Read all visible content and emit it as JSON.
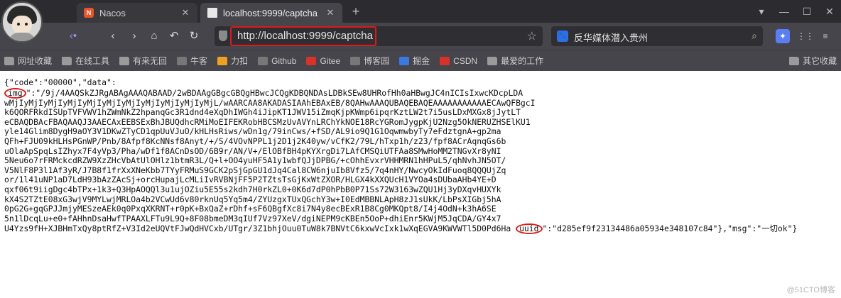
{
  "tabs": [
    {
      "title": "Nacos",
      "icon": "nacos-logo-icon"
    },
    {
      "title": "localhost:9999/captcha",
      "icon": "document-icon"
    }
  ],
  "nav": {
    "url": "http://localhost:9999/captcha",
    "search_text": "反华媒体潜入贵州"
  },
  "bookmarks": [
    {
      "label": "网址收藏",
      "icon": "folder-icon"
    },
    {
      "label": "在线工具",
      "icon": "folder-icon"
    },
    {
      "label": "有来无回",
      "icon": "folder-icon"
    },
    {
      "label": "牛客",
      "icon": "nowcoder-icon"
    },
    {
      "label": "力扣",
      "icon": "leetcode-icon"
    },
    {
      "label": "Github",
      "icon": "github-icon"
    },
    {
      "label": "Gitee",
      "icon": "gitee-icon"
    },
    {
      "label": "博客园",
      "icon": "cnblogs-icon"
    },
    {
      "label": "掘金",
      "icon": "juejin-icon"
    },
    {
      "label": "CSDN",
      "icon": "csdn-icon"
    },
    {
      "label": "最爱的工作",
      "icon": "folder-icon"
    },
    {
      "label": "其它收藏",
      "icon": "folder-icon"
    }
  ],
  "response": {
    "line1": "{\"code\":\"00000\",\"data\":",
    "img_key": "img",
    "img_lines": [
      "\":\"/9j/4AAQSkZJRgABAgAAAQABAAD/2wBDAAgGBgcGBQgHBwcJCQgKDBQNDAsLDBkSEw8UHRofHh0aHBwgJC4nICIsIxwcKDcpLDA",
      "wMjIyMjIyMjIyMjIyMjIyMjIyMjIyMjIyMjIyMjIyMjL/wAARCAA8AKADASIAAhEBAxEB/8QAHwAAAQUBAQEBAQEAAAAAAAAAAAECAwQFBgcI",
      "k6QORFRkdISUpTVFVWV1hZWmNkZ2hpanqGc3R1dnd4eXqDhIWGh4iJipKT1JWV15iZmqKjpKWmp6ipqrKztLW2t7i5usLDxMXGx8jJytLT",
      "eCBAQDBAcFBAQAAQJ3AAECAxEEBSExBhJBUQdhcRMiMoEIFEKRobHBCSMzUvAVYnLRChYkNOE18RcYGRomJygpKjU2Nzg5OkNERUZHSElKU1",
      "yle14Glim8DygH9aOY3V1DKwZTyCD1qpUuVJuO/kHLHsRiws/wDn1g/79inCws/+fSD/AL9io9Q1G1OqwmwbyTy7eFdztgnA+gp2ma",
      "QFh+FJU09kHLHsPGnWP/Pnb/8Afpf8KcNNsf8Anyt/+/S/4VOvNPPL1j2D1j2K40yw/vCfK2/79L/hTxp1h/z23/fpf8ACrAqnqGs6b",
      "uOlaApSpqLsIZhyx7F4yVp3/Pha/wDf1f8ACnDsOD/6B9r/AN/V+/ElOBfBH4pKYXrgDi7LAfCMSQiUTFAa8SMwHoMM2TNGvXr8yNI",
      "5Neu6o7rFRMckcdRZW9XzZHcVbAtUlOHlz1btmR3L/Q+l+OO4yuHF5A1y1wbfQJjDPBG/+cOhhEvxrVHHMRN1hHPuL5/qhNvhJN5OT/",
      "V5NlF8P3l1Af3yR/J7B8f1frXxXNeKbb7TYyFRMuS9GCK2pSjGpGU1dJq4Cal8CW6njuIb8Vfz5/7q4nHY/NwcyOkIdFuoq8QQQUjZq",
      "or/1l41uNP1aD7LdH93bAzZAcSj+orcHupajLcMLiIvRVBNjFF5P2TZtsTsGjKxWtZXOR/HLGX4kXXQUcH1VYOa4sDUbaAHb4YE+D",
      "qxf06t9iigDgc4bTPx+1k3+Q3HpAOQQl3u1ujOZiu5E55s2kdh7H0rkZL0+0K6d7dP0hPbB0P71Ss72W3163wZQU1Hj3yDXqvHUXYk",
      "kX4S2TZtE08xG3wjV9MYLwjMRLOa4b2VCwUd6v80rknUq5Yq5m4/ZYUzgxTUxQGchY3w+I0EdMBBNLApH8zJ1sUkK/LbPsXIGbj5hA",
      "0pG2G+gqGPJJmjyMESzeAEk0q0PxqXKRNT+r0pK+BxQaZ+rDhf+sF6QBgfXc8i7N4y8ecBExR1B8Cg0MKQpt8/I4j4OdN+k3hA6SE",
      "5n1lDcqLu+e0+fAHhnDsaHwfTPAAXLFTu9L9Q+8F08bmeDM3qIUf7Vz97XeV/dgiNEPM9cKBEn5OoP+dhiEnr5KWjM5JqCDA/GY4x7",
      "U4Yzs9fH+XJBHmTxQy8ptRfZ+V3Id2eUQVtFJwQdHVCxb/UTgr/3Z1bhjOuu0TuW8k7BNVtC6kxwVcIxk1wXqEGVA9KWVWTl5D0Pd6Ha"
    ],
    "uuid_key": "uuid",
    "uuid_tail": "\":\"d285ef9f23134486a05934e348107c84\"},\"msg\":\"一切ok\"}"
  },
  "watermark": "@51CTO博客"
}
